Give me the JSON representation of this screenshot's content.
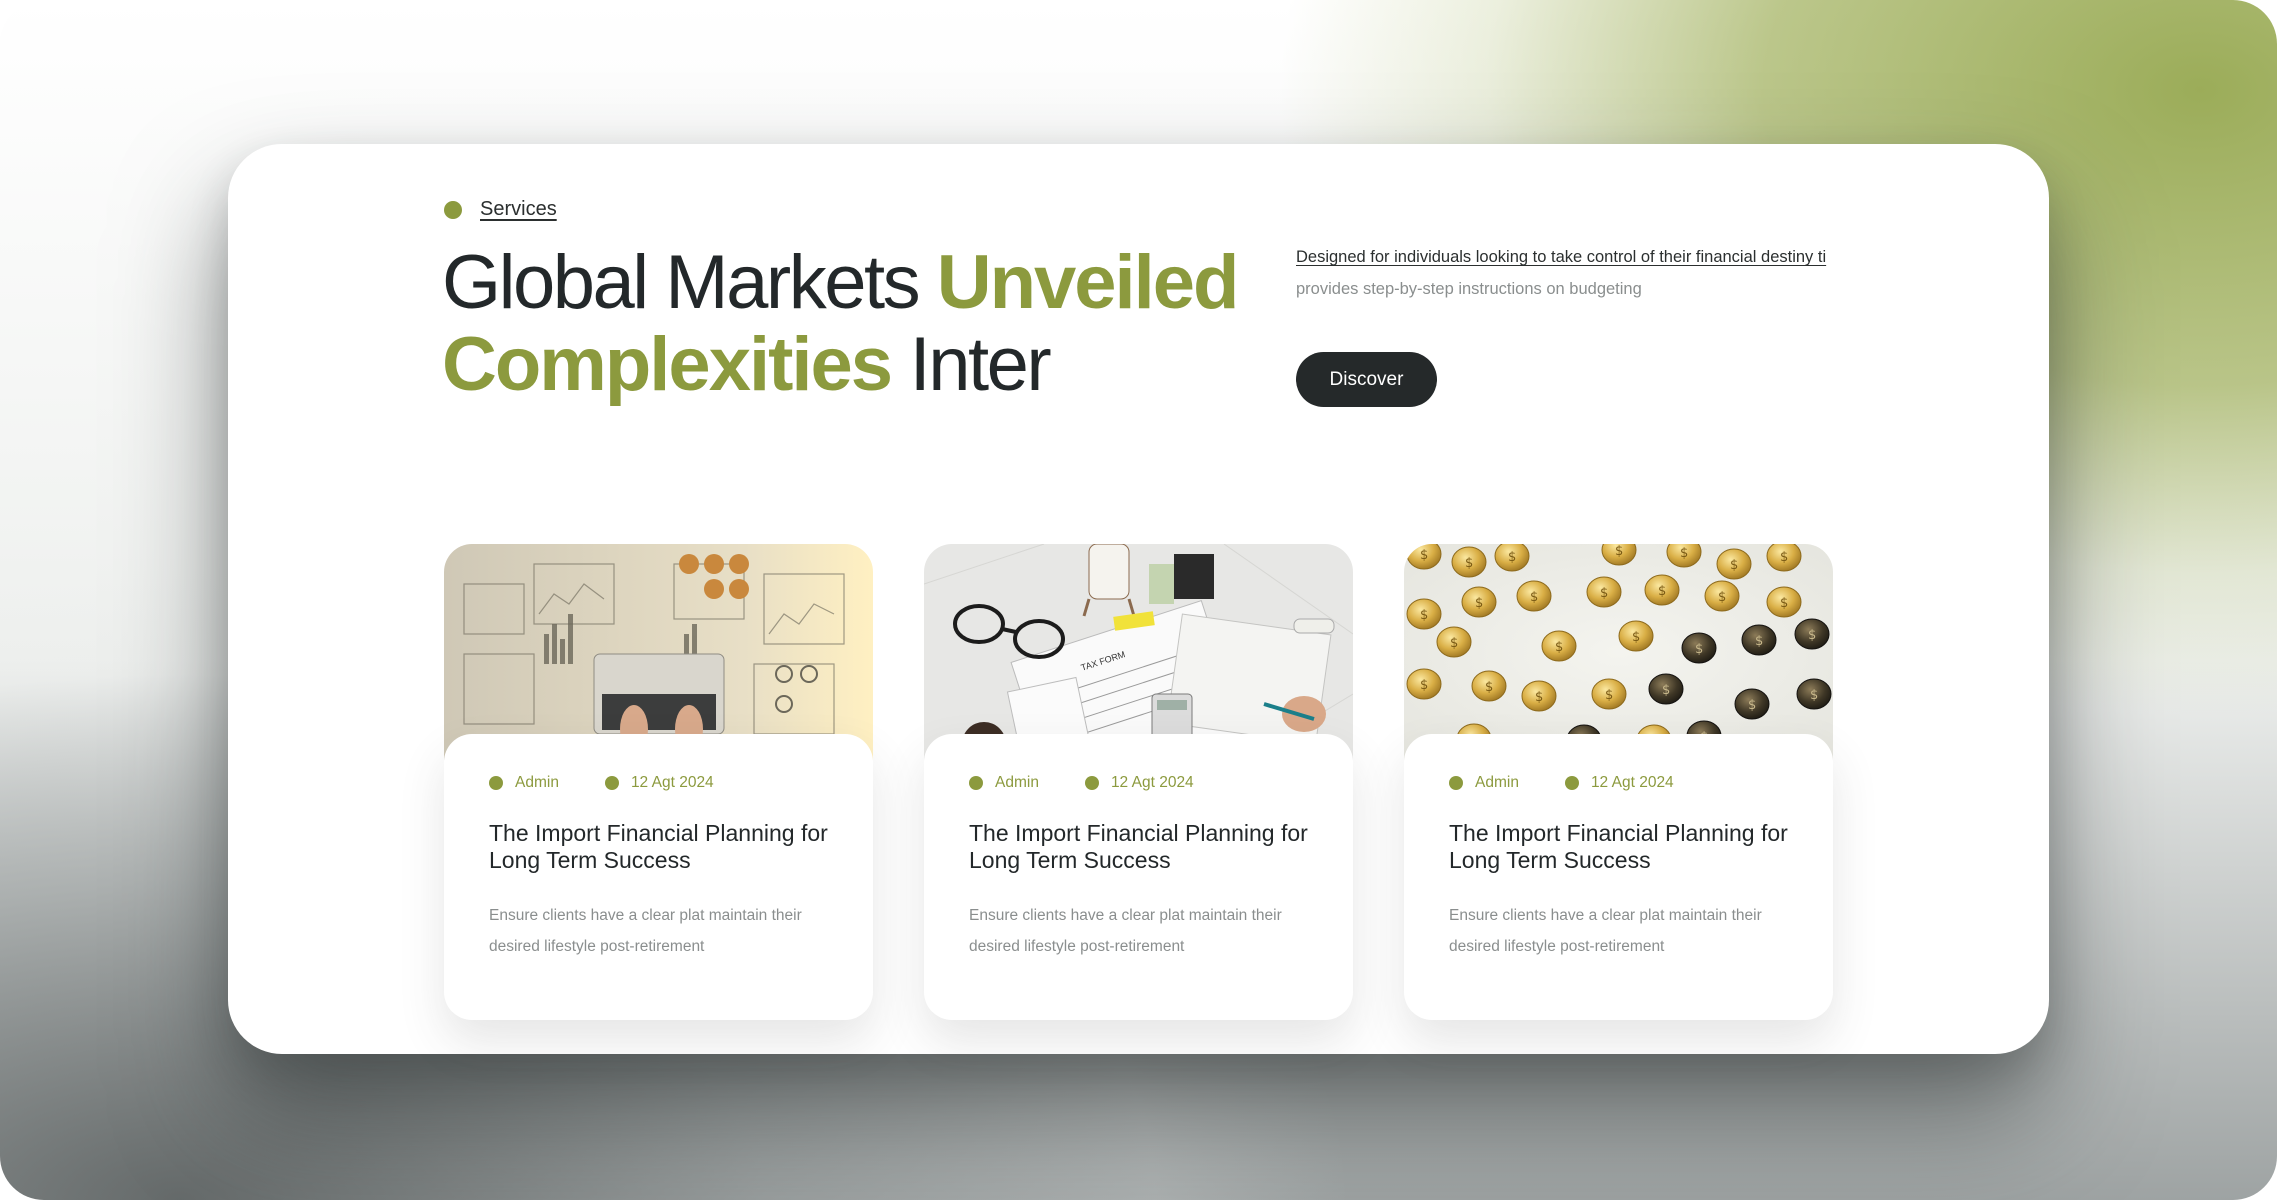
{
  "hero": {
    "badge_label": "Services",
    "headline_part1": "Global Markets ",
    "headline_accent1": "Unveiled",
    "headline_accent2": "Complexities",
    "headline_part2": " Inter",
    "description_line1": "Designed for individuals looking to take control of their financial destiny ti",
    "description_line2": "provides step-by-step instructions on budgeting",
    "cta_label": "Discover"
  },
  "posts": [
    {
      "author": "Admin",
      "date": "12 Agt 2024",
      "title": "The Import Financial Planning for Long Term Success",
      "excerpt": "Ensure clients have a clear plat maintain their desired lifestyle post-retirement",
      "image": "laptop-analytics-dashboard"
    },
    {
      "author": "Admin",
      "date": "12 Agt 2024",
      "title": "The Import Financial Planning for Long Term Success",
      "excerpt": "Ensure clients have a clear plat maintain their desired lifestyle post-retirement",
      "image": "tax-form-desk"
    },
    {
      "author": "Admin",
      "date": "12 Agt 2024",
      "title": "The Import Financial Planning for Long Term Success",
      "excerpt": "Ensure clients have a clear plat maintain their desired lifestyle post-retirement",
      "image": "gold-coins"
    }
  ],
  "colors": {
    "accent": "#8c9a3e",
    "dark": "#25292a",
    "muted_text": "#8a8e8e"
  }
}
